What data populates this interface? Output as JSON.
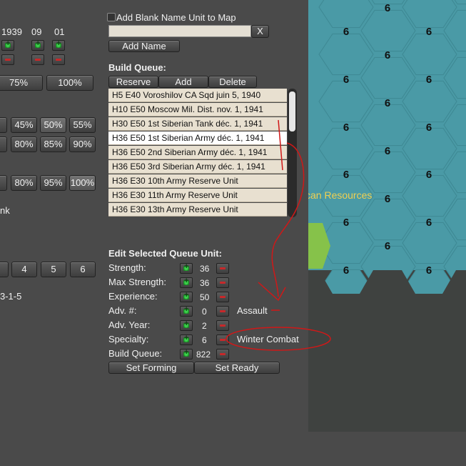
{
  "left_panel": {
    "years": [
      "1939",
      "09",
      "01"
    ],
    "pct_row1": [
      "75%",
      "100%"
    ],
    "pct_row2": [
      "%",
      "45%",
      "50%",
      "55%"
    ],
    "pct_row3": [
      "%",
      "80%",
      "85%",
      "90%"
    ],
    "pct_row4": [
      "%",
      "80%",
      "95%",
      "100%"
    ],
    "nk_label": "nk",
    "num_buttons": [
      "4",
      "5",
      "6"
    ],
    "code_label": "3-1-5"
  },
  "name_unit": {
    "checkbox_label": "Add Blank Name Unit to Map",
    "clear_label": "X",
    "add_name_label": "Add Name"
  },
  "build_queue": {
    "title": "Build Queue:",
    "buttons": [
      "Reserve",
      "Add",
      "Delete"
    ],
    "items": [
      "H5  E40  Voroshilov CA Sqd  juin 5, 1940",
      "H10  E50  Moscow Mil. Dist.  nov. 1, 1941",
      "H30  E50  1st Siberian Tank  déc. 1, 1941",
      "H36  E50  1st Siberian Army  déc. 1, 1941",
      "H36  E50  2nd Siberian Army  déc. 1, 1941",
      "H36  E50  3rd Siberian Army  déc. 1, 1941",
      "H36  E30  10th Army  Reserve Unit",
      "H36  E30  11th Army  Reserve Unit",
      "H36  E30  13th Army  Reserve Unit"
    ],
    "selected_index": 3
  },
  "edit_unit": {
    "title": "Edit Selected Queue Unit:",
    "fields": [
      {
        "label": "Strength:",
        "value": "36"
      },
      {
        "label": "Max Strength:",
        "value": "36"
      },
      {
        "label": "Experience:",
        "value": "50"
      },
      {
        "label": "Adv. #:",
        "value": "0",
        "extra": "Assault"
      },
      {
        "label": "Adv. Year:",
        "value": "2"
      },
      {
        "label": "Specialty:",
        "value": "6",
        "extra": "Winter Combat"
      },
      {
        "label": "Build Queue:",
        "value": "822"
      }
    ],
    "set_forming_label": "Set Forming",
    "set_ready_label": "Set Ready"
  },
  "map": {
    "resources_label": "can Resources",
    "hex_value": "6",
    "colors": {
      "water": "#4a9aa6",
      "land": "#3f4240",
      "resources_text": "#f0d050"
    }
  }
}
